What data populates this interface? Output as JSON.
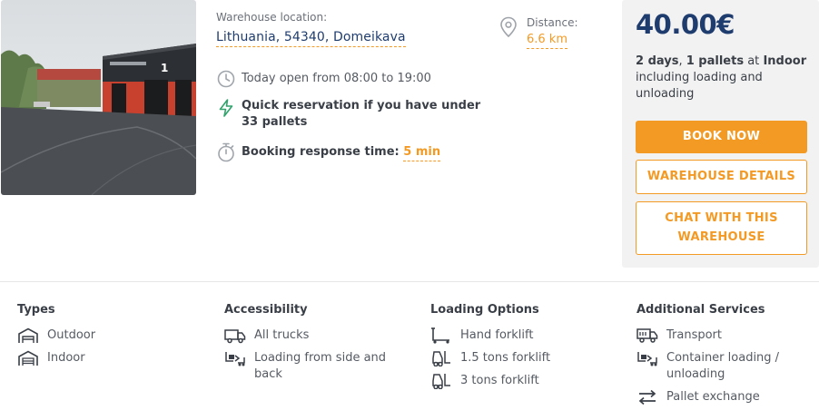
{
  "location": {
    "label": "Warehouse location:",
    "value": "Lithuania, 54340, Domeikava"
  },
  "distance": {
    "label": "Distance:",
    "value": "6.6 km"
  },
  "details": {
    "open_hours": "Today open from 08:00 to 19:00",
    "quick_reservation": "Quick reservation if you have under 33 pallets",
    "response_label": "Booking response time:",
    "response_value": "5 min"
  },
  "price": {
    "amount": "40.00€",
    "days": "2 days",
    "pallets": "1 pallets",
    "at": "at",
    "storage": "Indoor",
    "including": "including loading and unloading"
  },
  "buttons": {
    "book": "BOOK NOW",
    "details": "WAREHOUSE DETAILS",
    "chat": "CHAT WITH THIS WAREHOUSE"
  },
  "features": {
    "types": {
      "title": "Types",
      "items": [
        {
          "icon": "outdoor-warehouse-icon",
          "label": "Outdoor"
        },
        {
          "icon": "indoor-warehouse-icon",
          "label": "Indoor"
        }
      ]
    },
    "accessibility": {
      "title": "Accessibility",
      "items": [
        {
          "icon": "truck-icon",
          "label": "All trucks"
        },
        {
          "icon": "loading-side-icon",
          "label": "Loading from side and back"
        }
      ]
    },
    "loading": {
      "title": "Loading Options",
      "items": [
        {
          "icon": "hand-forklift-icon",
          "label": "Hand forklift"
        },
        {
          "icon": "forklift-icon",
          "label": "1.5 tons forklift"
        },
        {
          "icon": "forklift-icon",
          "label": "3 tons forklift"
        }
      ]
    },
    "services": {
      "title": "Additional Services",
      "items": [
        {
          "icon": "transport-truck-icon",
          "label": "Transport"
        },
        {
          "icon": "container-loading-icon",
          "label": "Container loading / unloading"
        },
        {
          "icon": "pallet-exchange-icon",
          "label": "Pallet exchange"
        }
      ]
    }
  },
  "photo": {
    "building_sign": "1"
  },
  "colors": {
    "accent": "#f39a25",
    "navy": "#1f3c6e",
    "quick_icon": "#2fa36b"
  }
}
